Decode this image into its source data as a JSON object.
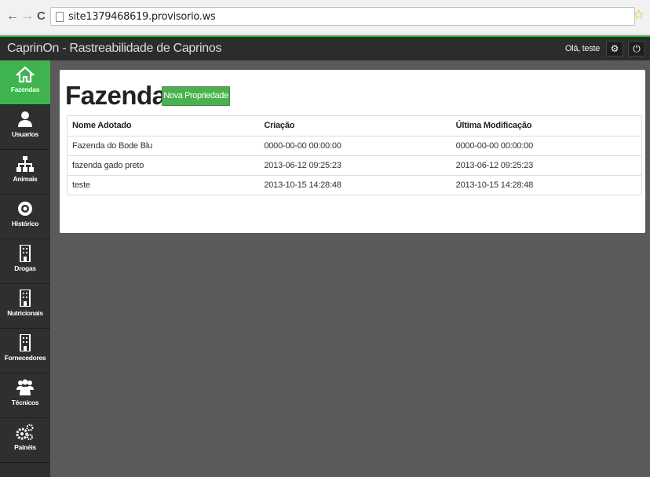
{
  "browser": {
    "url": "site1379468619.provisorio.ws",
    "back": "←",
    "forward": "→",
    "reload": "C",
    "star": "☆"
  },
  "header": {
    "title": "CaprinOn - Rastreabilidade de Caprinos",
    "greeting": "Olá, teste",
    "settings_glyph": "⚙",
    "power_glyph": "⏻"
  },
  "sidebar": {
    "items": [
      {
        "label": "Fazendas",
        "icon": "home-icon",
        "active": true
      },
      {
        "label": "Usuarios",
        "icon": "user-icon",
        "active": false
      },
      {
        "label": "Animais",
        "icon": "sitemap-icon",
        "active": false
      },
      {
        "label": "Histórico",
        "icon": "eye-icon",
        "active": false
      },
      {
        "label": "Drogas",
        "icon": "building-icon",
        "active": false
      },
      {
        "label": "Nutricionais",
        "icon": "building-icon",
        "active": false
      },
      {
        "label": "Fornecedores",
        "icon": "building-icon",
        "active": false
      },
      {
        "label": "Técnicos",
        "icon": "group-icon",
        "active": false
      },
      {
        "label": "Painéis",
        "icon": "cogs-icon",
        "active": false
      }
    ]
  },
  "main": {
    "title": "Fazendas",
    "new_button": "Nova Propriedade",
    "table": {
      "headers": [
        "Nome Adotado",
        "Criação",
        "Última Modificação"
      ],
      "rows": [
        [
          "Fazenda do Bode Blu",
          "0000-00-00 00:00:00",
          "0000-00-00 00:00:00"
        ],
        [
          "fazenda gado preto",
          "2013-06-12 09:25:23",
          "2013-06-12 09:25:23"
        ],
        [
          "teste",
          "2013-10-15 14:28:48",
          "2013-10-15 14:28:48"
        ]
      ]
    }
  },
  "colors": {
    "accent": "#3fb34f",
    "header_bg": "#2c2c2c",
    "sidebar_bg": "#2f2f2f",
    "main_bg": "#5a5a5a"
  }
}
